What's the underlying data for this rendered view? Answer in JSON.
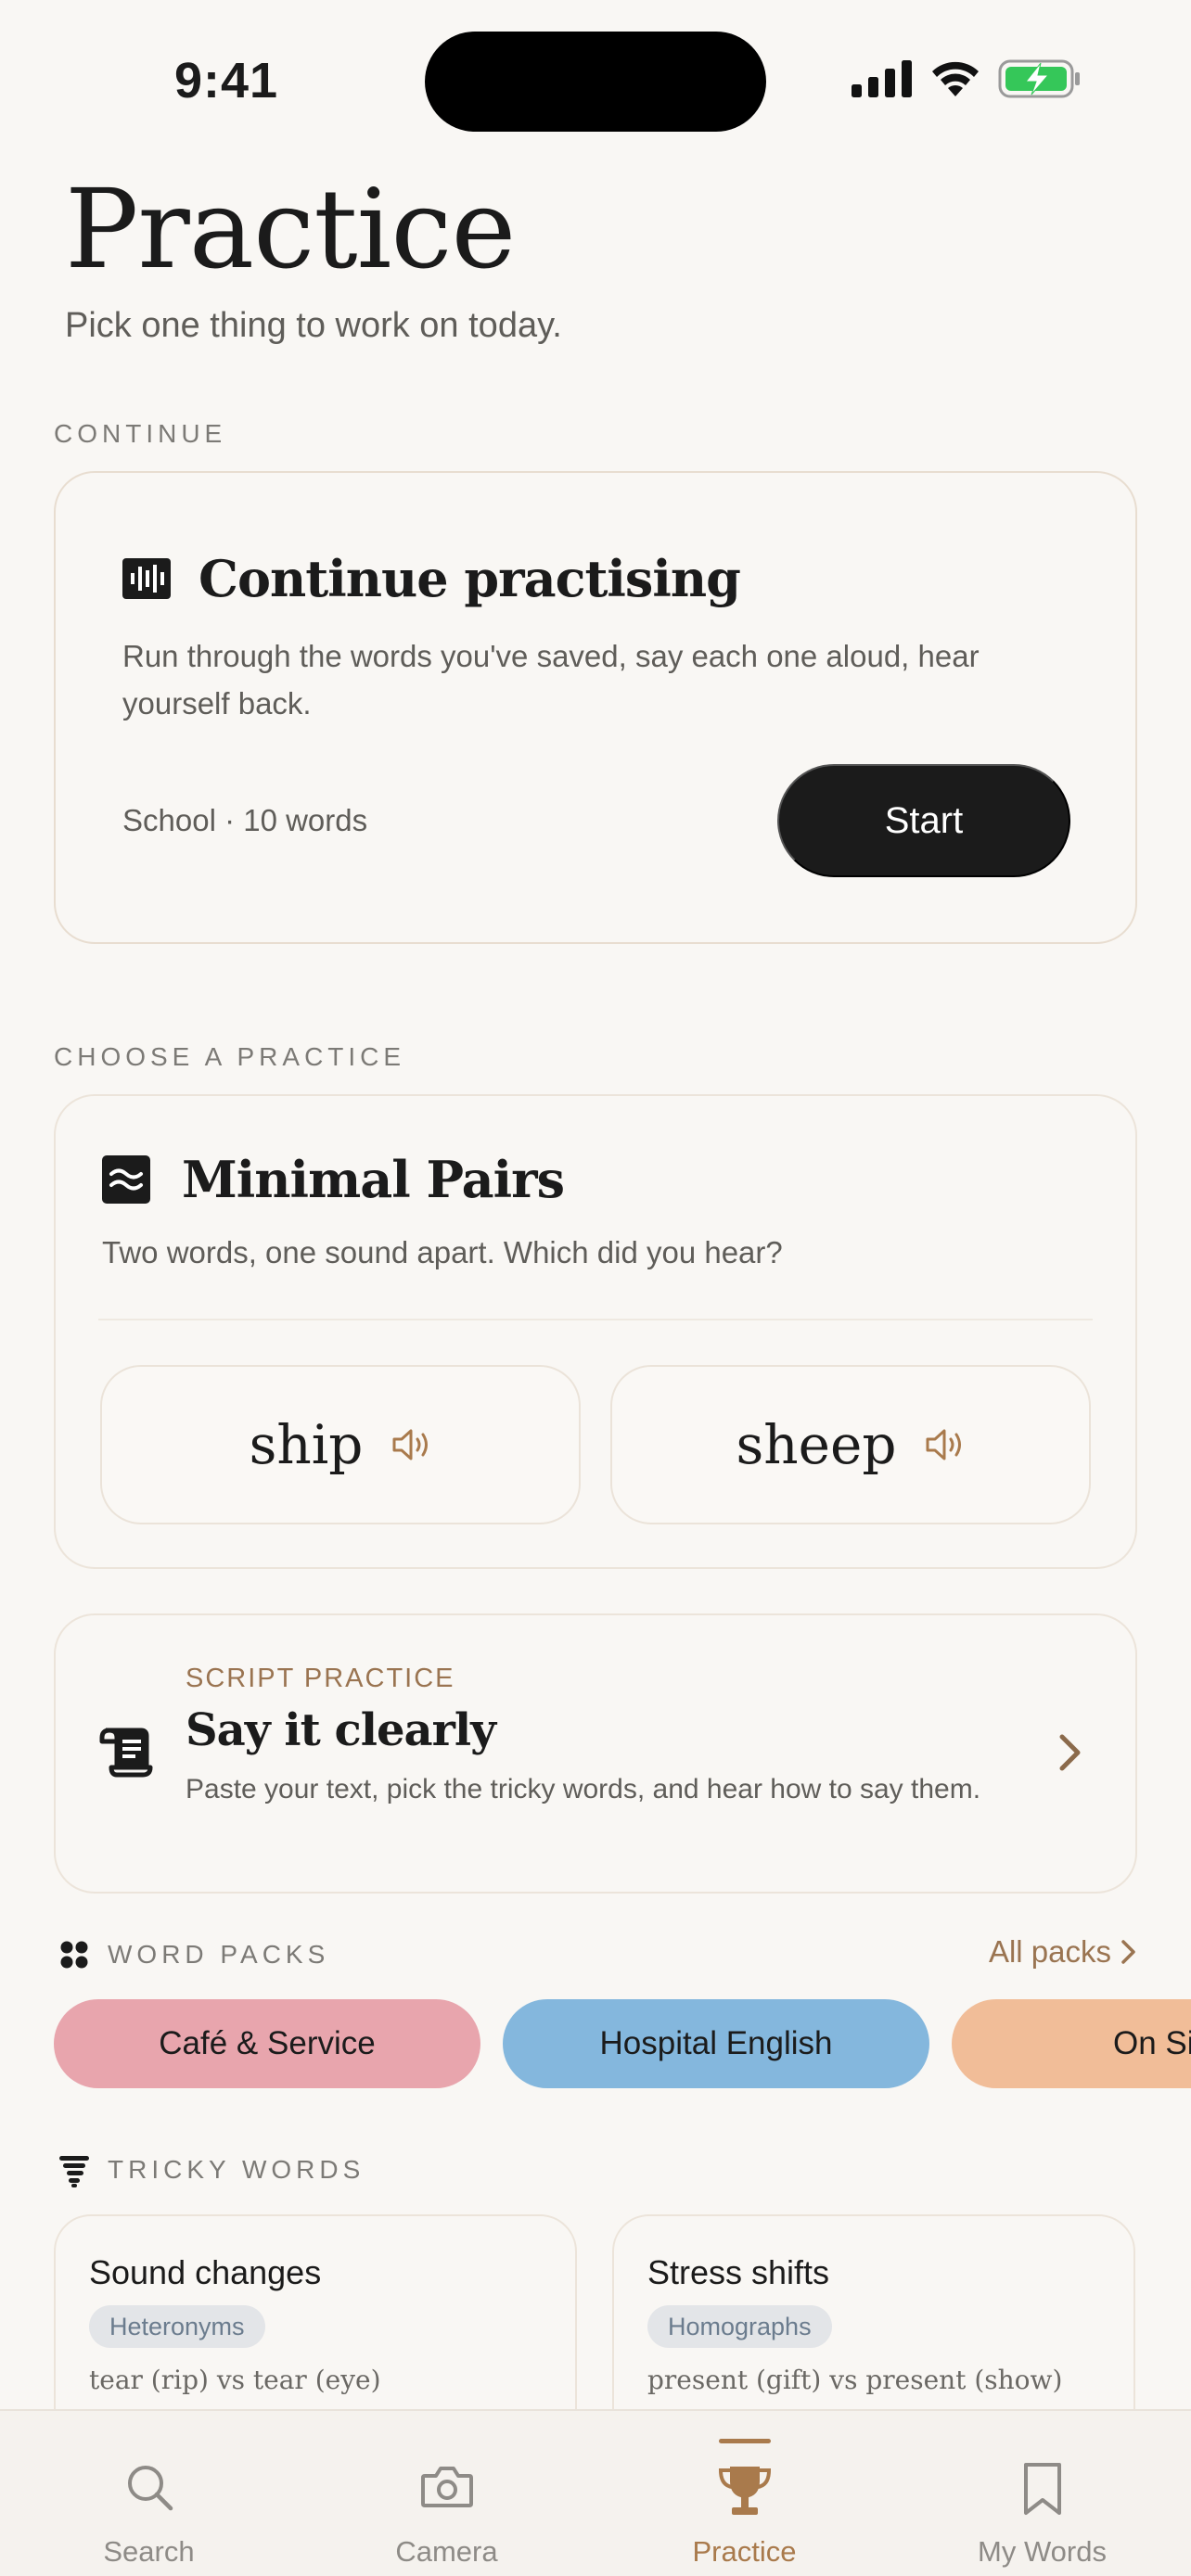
{
  "status_bar": {
    "time": "9:41"
  },
  "header": {
    "title": "Practice",
    "subtitle": "Pick one thing to work on today."
  },
  "continue_section": {
    "label": "CONTINUE",
    "card": {
      "icon": "waveform-icon",
      "title": "Continue practising",
      "description": "Run through the words you've saved, say each one aloud, hear yourself back.",
      "meta": "School · 10 words",
      "start_label": "Start"
    }
  },
  "choose_section": {
    "label": "CHOOSE A PRACTICE",
    "minimal_pairs": {
      "icon": "waves-icon",
      "title": "Minimal Pairs",
      "description": "Two words, one sound apart. Which did you hear?",
      "pairs": [
        "ship",
        "sheep"
      ]
    },
    "script_practice": {
      "icon": "scroll-icon",
      "eyebrow": "SCRIPT PRACTICE",
      "title": "Say it clearly",
      "description": "Paste your text, pick the tricky words, and hear how to say them."
    }
  },
  "word_packs": {
    "label": "WORD PACKS",
    "all_label": "All packs",
    "packs": [
      {
        "name": "Café & Service",
        "color": "#e8a5ad"
      },
      {
        "name": "Hospital English",
        "color": "#84b7dd"
      },
      {
        "name": "On Si",
        "color": "#f1bd98"
      }
    ]
  },
  "tricky_words": {
    "label": "TRICKY WORDS",
    "cards": [
      {
        "title": "Sound changes",
        "tag": "Heteronyms",
        "example": "tear (rip) vs tear (eye)"
      },
      {
        "title": "Stress shifts",
        "tag": "Homographs",
        "example": "present (gift) vs present (show)"
      }
    ]
  },
  "tab_bar": {
    "active": "Practice",
    "accent": "#a97a4c",
    "tabs": [
      {
        "label": "Search",
        "icon": "search-icon"
      },
      {
        "label": "Camera",
        "icon": "camera-icon"
      },
      {
        "label": "Practice",
        "icon": "trophy-icon"
      },
      {
        "label": "My Words",
        "icon": "bookmark-icon"
      }
    ]
  }
}
